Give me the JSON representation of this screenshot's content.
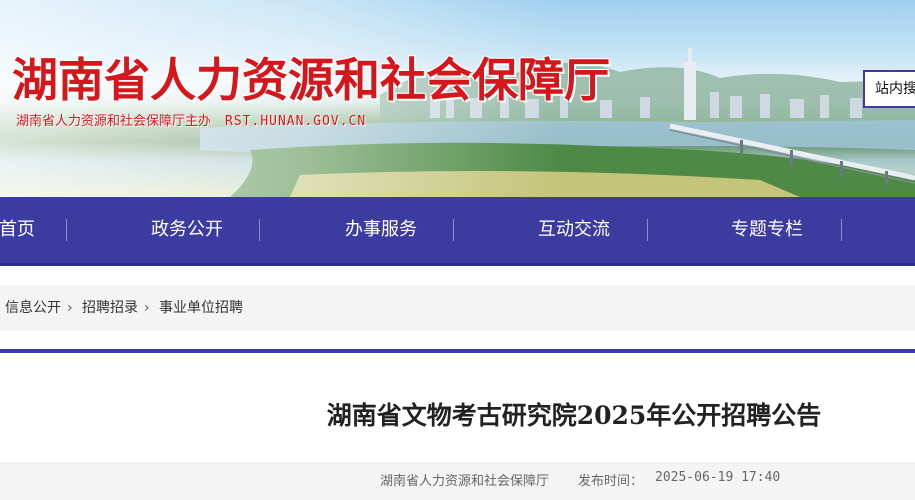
{
  "header": {
    "title": "湖南省人力资源和社会保障厅",
    "subtitle": "湖南省人力资源和社会保障厅主办",
    "url": "RST.HUNAN.GOV.CN",
    "search_label": "站内搜"
  },
  "nav": {
    "items": [
      {
        "label": "首页"
      },
      {
        "label": "政务公开"
      },
      {
        "label": "办事服务"
      },
      {
        "label": "互动交流"
      },
      {
        "label": "专题专栏"
      }
    ]
  },
  "breadcrumb": {
    "items": [
      "信息公开",
      "招聘招录",
      "事业单位招聘"
    ],
    "separator": "›"
  },
  "article": {
    "title": "湖南省文物考古研究院2025年公开招聘公告",
    "source": "湖南省人力资源和社会保障厅",
    "published_label": "发布时间：",
    "published_value": "2025-06-19 17:40"
  },
  "colors": {
    "brand_red": "#d5171c",
    "nav_blue": "#3c3ca0"
  }
}
